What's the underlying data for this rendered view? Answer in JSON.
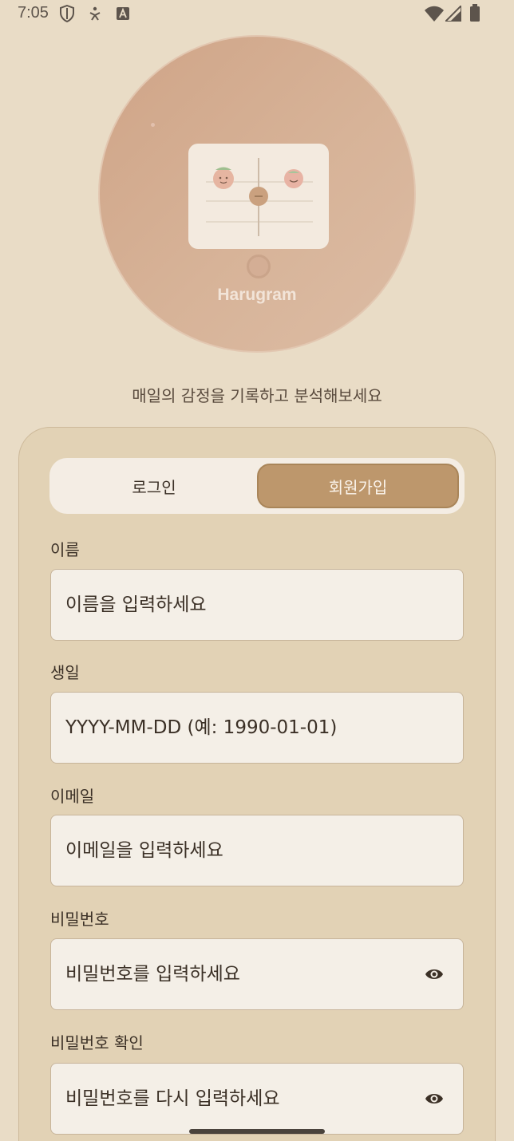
{
  "status_bar": {
    "time": "7:05",
    "left_icons": [
      "shield-icon",
      "accessibility-icon",
      "text-a-icon"
    ],
    "right_icons": [
      "wifi-icon",
      "signal-icon",
      "battery-icon"
    ]
  },
  "hero": {
    "app_name": "Harugram"
  },
  "tagline": "매일의 감정을 기록하고 분석해보세요",
  "tabs": {
    "login_label": "로그인",
    "signup_label": "회원가입",
    "active": "signup"
  },
  "form": {
    "name": {
      "label": "이름",
      "placeholder": "이름을 입력하세요",
      "value": ""
    },
    "birthday": {
      "label": "생일",
      "placeholder": "YYYY-MM-DD (예: 1990-01-01)",
      "value": ""
    },
    "email": {
      "label": "이메일",
      "placeholder": "이메일을 입력하세요",
      "value": ""
    },
    "password": {
      "label": "비밀번호",
      "placeholder": "비밀번호를 입력하세요",
      "value": "",
      "icon": "eye-icon"
    },
    "password_confirm": {
      "label": "비밀번호 확인",
      "placeholder": "비밀번호를 다시 입력하세요",
      "value": "",
      "icon": "eye-icon"
    }
  },
  "colors": {
    "background": "#e9dcc6",
    "panel": "#e2d2b5",
    "accent": "#bd976c",
    "field": "#f4efe7"
  }
}
